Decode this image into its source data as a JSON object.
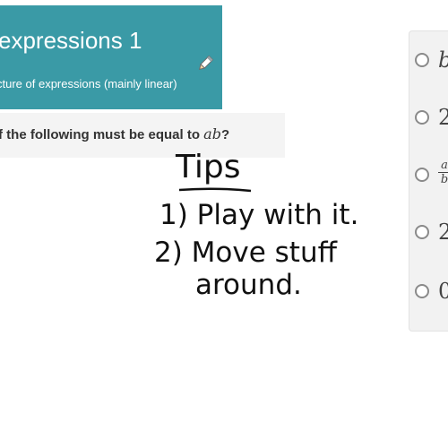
{
  "exercise": {
    "title": "expressions 1",
    "subtitle": "cture of expressions (mainly linear)",
    "edit_icon": "pencil-icon"
  },
  "question": {
    "text_before": "f the following must be equal to ",
    "variable": "ab",
    "text_after": "?"
  },
  "choices": [
    {
      "text": "b",
      "italic": true
    },
    {
      "text": "2",
      "italic": false
    },
    {
      "text": "",
      "numerator": "a",
      "denominator": "b"
    },
    {
      "text": "2",
      "italic": false
    },
    {
      "text": "0",
      "italic": false
    }
  ],
  "handwritten": {
    "heading": "Tips",
    "line1": "1) Play with it.",
    "line2": "2) Move stuff",
    "line3": "around."
  },
  "colors": {
    "header": "#3a9aa6",
    "question_bar": "#f4f4f4",
    "choices_panel": "#f2f2f2"
  }
}
